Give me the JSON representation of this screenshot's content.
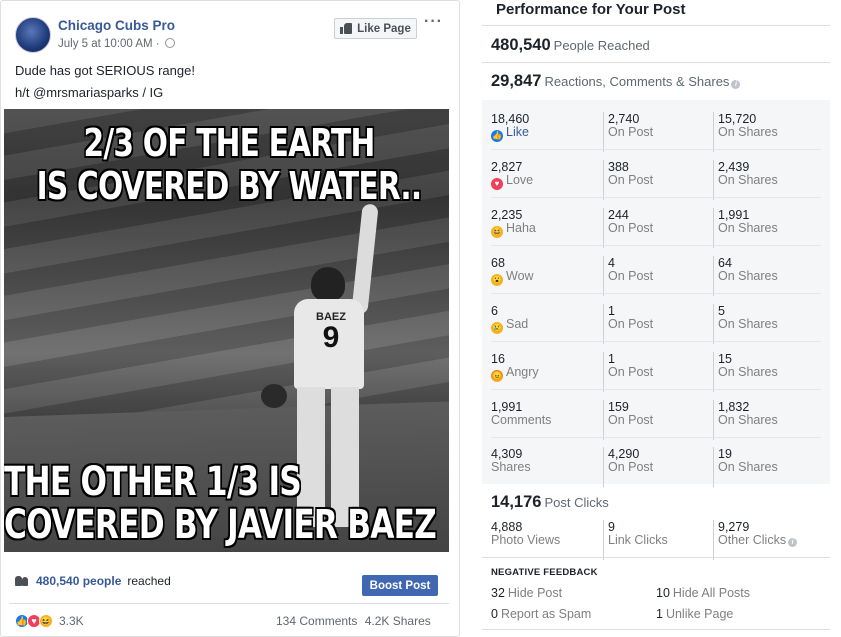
{
  "post": {
    "page_name": "Chicago Cubs Pro",
    "meta": "July 5 at 10:00 AM ·",
    "like_page_label": "Like Page",
    "more_label": "···",
    "text_line1": "Dude has got SERIOUS range!",
    "text_line2": "h/t @mrsmariasparks / IG",
    "meme_top1": "2/3 OF THE EARTH",
    "meme_top2": "IS COVERED BY WATER..",
    "meme_bottom1": "THE OTHER 1/3 IS",
    "meme_bottom2": "COVERED BY JAVIER BAEZ",
    "jersey_name": "BAEZ",
    "jersey_number": "9",
    "reach_count": "480,540 people",
    "reach_suffix": "reached",
    "boost_label": "Boost Post",
    "reactions_total": "3.3K",
    "comments": "134 Comments",
    "shares": "4.2K Shares"
  },
  "performance": {
    "title": "Performance for Your Post",
    "people_reached": "480,540",
    "people_reached_label": "People Reached",
    "engagement": "29,847",
    "engagement_label": "Reactions, Comments & Shares",
    "rows": [
      {
        "total": "18,460",
        "label": "Like",
        "icon": "like-icon",
        "on_post": "2,740",
        "on_post_label": "On Post",
        "on_shares": "15,720",
        "on_shares_label": "On Shares"
      },
      {
        "total": "2,827",
        "label": "Love",
        "icon": "love-icon",
        "on_post": "388",
        "on_post_label": "On Post",
        "on_shares": "2,439",
        "on_shares_label": "On Shares"
      },
      {
        "total": "2,235",
        "label": "Haha",
        "icon": "haha-icon",
        "on_post": "244",
        "on_post_label": "On Post",
        "on_shares": "1,991",
        "on_shares_label": "On Shares"
      },
      {
        "total": "68",
        "label": "Wow",
        "icon": "wow-icon",
        "on_post": "4",
        "on_post_label": "On Post",
        "on_shares": "64",
        "on_shares_label": "On Shares"
      },
      {
        "total": "6",
        "label": "Sad",
        "icon": "sad-icon",
        "on_post": "1",
        "on_post_label": "On Post",
        "on_shares": "5",
        "on_shares_label": "On Shares"
      },
      {
        "total": "16",
        "label": "Angry",
        "icon": "angry-icon",
        "on_post": "1",
        "on_post_label": "On Post",
        "on_shares": "15",
        "on_shares_label": "On Shares"
      },
      {
        "total": "1,991",
        "label": "Comments",
        "icon": "",
        "on_post": "159",
        "on_post_label": "On Post",
        "on_shares": "1,832",
        "on_shares_label": "On Shares"
      },
      {
        "total": "4,309",
        "label": "Shares",
        "icon": "",
        "on_post": "4,290",
        "on_post_label": "On Post",
        "on_shares": "19",
        "on_shares_label": "On Shares"
      }
    ],
    "post_clicks": "14,176",
    "post_clicks_label": "Post Clicks",
    "photo_views": "4,888",
    "photo_views_label": "Photo Views",
    "link_clicks": "9",
    "link_clicks_label": "Link Clicks",
    "other_clicks": "9,279",
    "other_clicks_label": "Other Clicks",
    "negative_title": "NEGATIVE FEEDBACK",
    "hide_post": "32",
    "hide_post_label": "Hide Post",
    "hide_all": "10",
    "hide_all_label": "Hide All Posts",
    "spam": "0",
    "spam_label": "Report as Spam",
    "unlike": "1",
    "unlike_label": "Unlike Page"
  },
  "colors": {
    "link": "#385898",
    "boost": "#4267b2",
    "like": "#1877f2",
    "love": "#f33e58",
    "haha": "#f7b125"
  }
}
